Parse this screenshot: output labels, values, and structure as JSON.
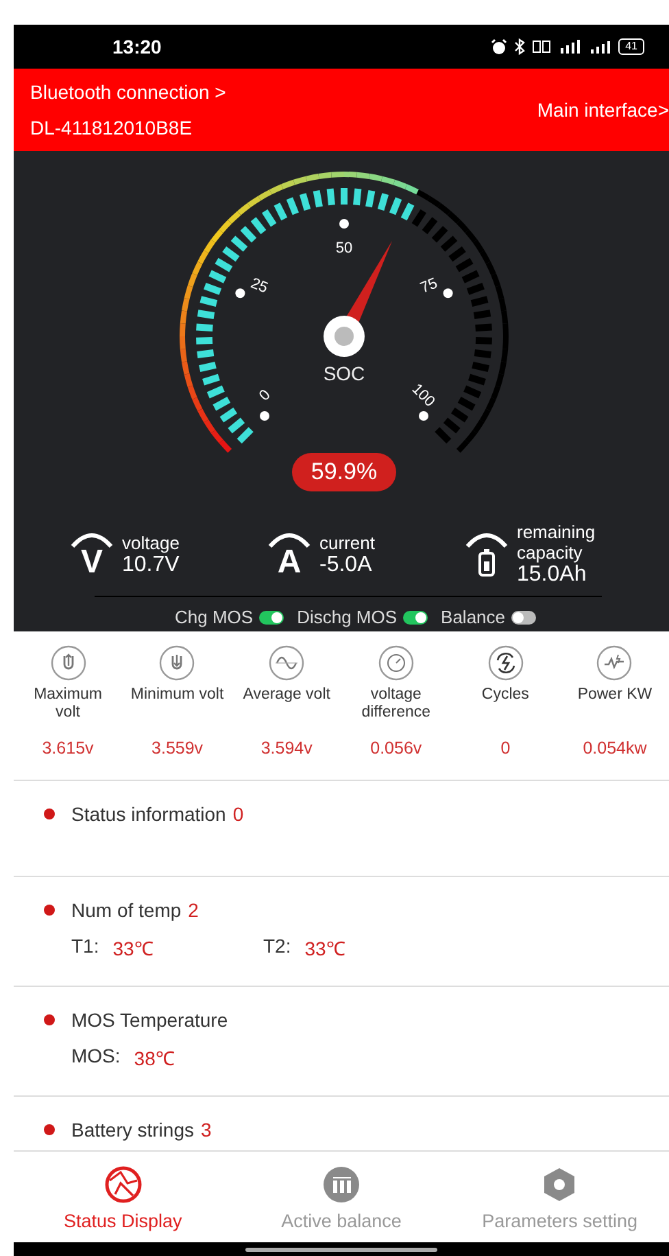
{
  "status_bar": {
    "time": "13:20",
    "battery": "41"
  },
  "header": {
    "bluetooth_link": "Bluetooth connection >",
    "device": "DL-411812010B8E",
    "main_link": "Main interface>"
  },
  "gauge": {
    "label": "SOC",
    "scale": [
      "0",
      "25",
      "50",
      "75",
      "100"
    ],
    "reading": "59.9%"
  },
  "metrics": [
    {
      "kind": "letter",
      "symbol": "V",
      "label": "voltage",
      "value": "10.7V"
    },
    {
      "kind": "letter",
      "symbol": "A",
      "label": "current",
      "value": "-5.0A"
    },
    {
      "kind": "battery",
      "label": "remaining capacity",
      "value": "15.0Ah"
    }
  ],
  "switches": [
    {
      "label": "Chg MOS",
      "on": true
    },
    {
      "label": "Dischg MOS",
      "on": true
    },
    {
      "label": "Balance",
      "on": false
    }
  ],
  "stats": [
    {
      "kind": "max",
      "label": "Maximum volt",
      "value": "3.615v"
    },
    {
      "kind": "min",
      "label": "Minimum volt",
      "value": "3.559v"
    },
    {
      "kind": "wave",
      "label": "Average volt",
      "value": "3.594v"
    },
    {
      "kind": "dial",
      "label": "voltage difference",
      "value": "0.056v"
    },
    {
      "kind": "cycle",
      "label": "Cycles",
      "value": "0"
    },
    {
      "kind": "power",
      "label": "Power KW",
      "value": "0.054kw"
    }
  ],
  "sections": [
    {
      "title": "Status information",
      "count": "0"
    },
    {
      "title": "Num of temp",
      "count": "2",
      "readings": [
        {
          "label": "T1:",
          "value": "33℃"
        },
        {
          "label": "T2:",
          "value": "33℃"
        }
      ]
    },
    {
      "title": "MOS Temperature",
      "readings": [
        {
          "label": "MOS:",
          "value": "38℃"
        }
      ]
    },
    {
      "title": "Battery strings",
      "count": "3"
    }
  ],
  "nav": [
    {
      "kind": "status",
      "label": "Status Display",
      "selected": true
    },
    {
      "kind": "balance",
      "label": "Active balance",
      "selected": false
    },
    {
      "kind": "settings",
      "label": "Parameters setting",
      "selected": false
    }
  ]
}
